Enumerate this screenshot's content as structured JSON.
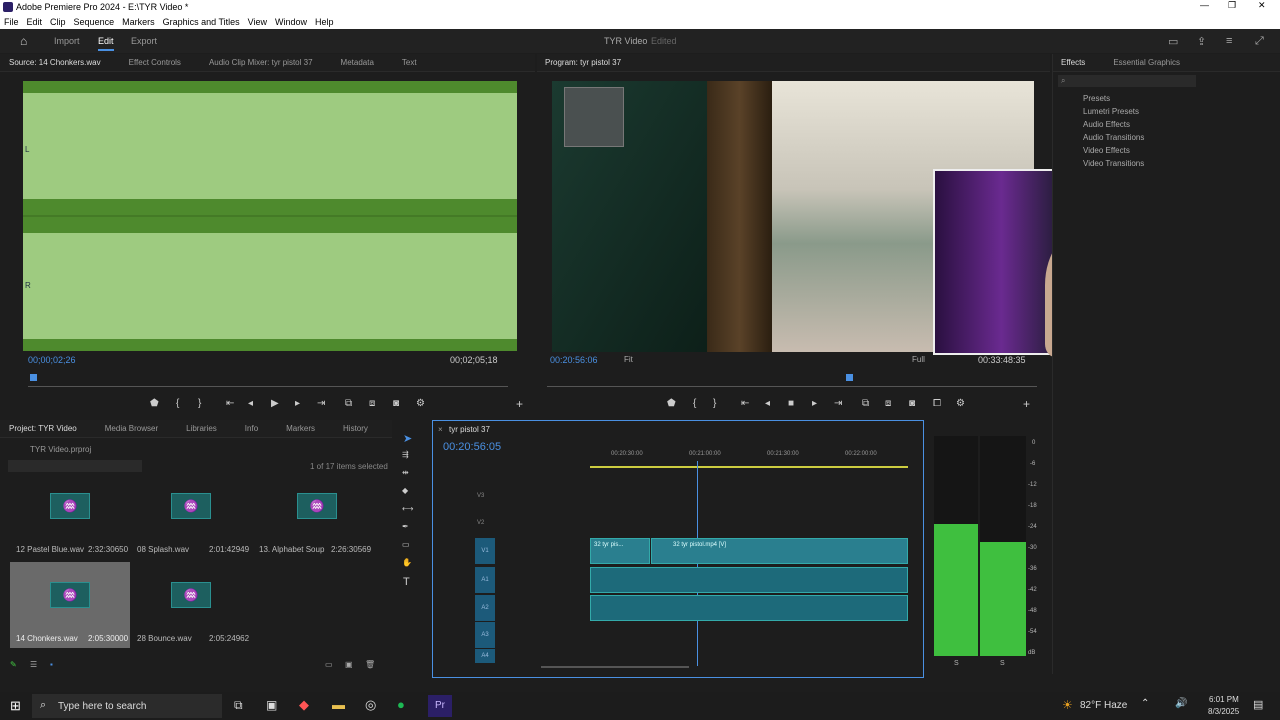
{
  "window": {
    "title": "Adobe Premiere Pro 2024 - E:\\TYR Video *"
  },
  "menu": [
    "File",
    "Edit",
    "Clip",
    "Sequence",
    "Markers",
    "Graphics and Titles",
    "View",
    "Window",
    "Help"
  ],
  "appbar": {
    "tabs": [
      "Import",
      "Edit",
      "Export"
    ],
    "project_name": "TYR Video",
    "status": "Edited"
  },
  "source": {
    "tabs": [
      "Source: 14 Chonkers.wav",
      "Effect Controls",
      "Audio Clip Mixer: tyr pistol 37",
      "Metadata",
      "Text"
    ],
    "timecode_in": "00;00;02;26",
    "timecode_dur": "00;02;05;18",
    "ch_labels": [
      "L",
      "R"
    ]
  },
  "program": {
    "title": "Program: tyr pistol 37",
    "timecode": "00:20:56:06",
    "fit": "Fit",
    "quality": "Full",
    "duration": "00:33:48:35"
  },
  "effects": {
    "tabs": [
      "Effects",
      "Essential Graphics"
    ],
    "items": [
      "Presets",
      "Lumetri Presets",
      "Audio Effects",
      "Audio Transitions",
      "Video Effects",
      "Video Transitions"
    ]
  },
  "project": {
    "tabs": [
      "Project: TYR Video",
      "Media Browser",
      "Libraries",
      "Info",
      "Markers",
      "History"
    ],
    "file": "TYR Video.prproj",
    "count": "1 of 17 items selected",
    "items": [
      {
        "name": "12 Pastel Blue.wav",
        "dur": "2:32:30650"
      },
      {
        "name": "08 Splash.wav",
        "dur": "2:01:42949"
      },
      {
        "name": "13. Alphabet Soup...",
        "dur": "2:26:30569"
      },
      {
        "name": "14 Chonkers.wav",
        "dur": "2:05:30000"
      },
      {
        "name": "28 Bounce.wav",
        "dur": "2:05:24962"
      }
    ]
  },
  "timeline": {
    "title": "tyr pistol 37",
    "timecode": "00:20:56:05",
    "ruler": [
      "00:20:30:00",
      "00:21:00:00",
      "00:21:30:00",
      "00:22:00:00"
    ],
    "tracks": [
      "V3",
      "V2",
      "V1",
      "A1",
      "A2",
      "A3",
      "A4"
    ],
    "clip1": "32 tyr pis...",
    "clip2": "32 tyr pistol.mp4 [V]"
  },
  "meters": {
    "scale": [
      "0",
      "-6",
      "-12",
      "-18",
      "-24",
      "-30",
      "-36",
      "-42",
      "-48",
      "-54",
      "dB"
    ],
    "footer": [
      "S",
      "S"
    ],
    "levels": [
      0.6,
      0.52
    ]
  },
  "taskbar": {
    "search": "Type here to search",
    "weather": "82°F Haze",
    "time": "6:01 PM",
    "date": "8/3/2025"
  }
}
